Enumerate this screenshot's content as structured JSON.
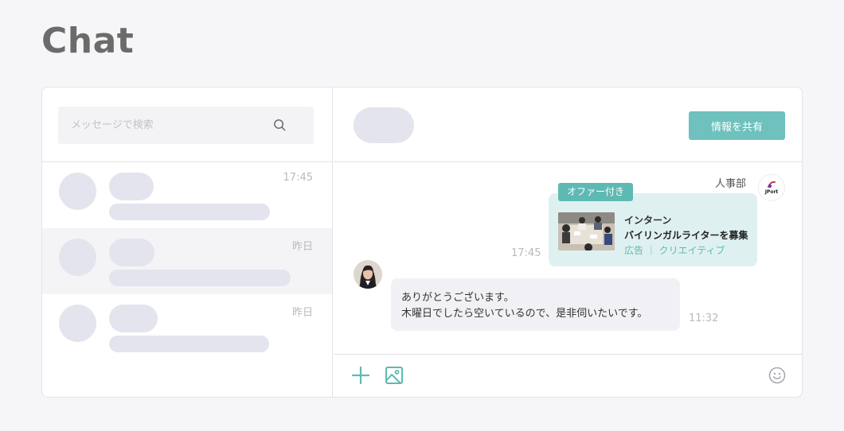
{
  "page": {
    "title": "Chat"
  },
  "search": {
    "placeholder": "メッセージで検索",
    "icon": "search-icon"
  },
  "conversations": [
    {
      "time": "17:45"
    },
    {
      "time": "昨日"
    },
    {
      "time": "昨日"
    }
  ],
  "header": {
    "share_label": "情報を共有"
  },
  "thread": {
    "sender_name": "人事部",
    "company_logo_text": "JPort",
    "offer": {
      "badge": "オファー付き",
      "type": "インターン",
      "title": "バイリンガルライターを募集",
      "tags": "広告 ｜ クリエイティブ",
      "time": "17:45"
    },
    "reply": {
      "line1": "ありがとうございます。",
      "line2": "木曜日でしたら空いているので、是非伺いたいです。",
      "time": "11:32"
    }
  },
  "composer": {
    "icons": [
      "add-icon",
      "image-icon",
      "emoji-icon"
    ]
  },
  "colors": {
    "accent": "#6ec1bc",
    "badge": "#5fb9b3",
    "offer_bg": "#def1f0",
    "placeholder": "#e4e4ee"
  }
}
